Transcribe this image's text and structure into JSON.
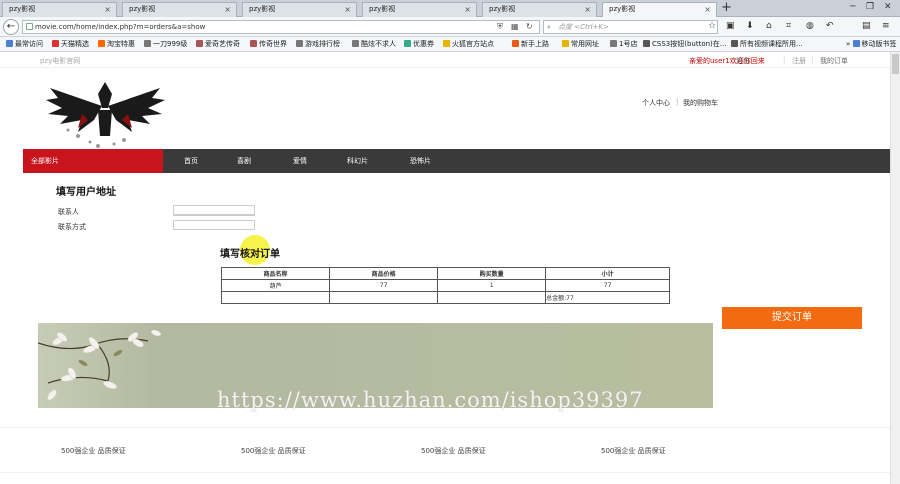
{
  "browser": {
    "tabs": [
      {
        "label": "pzy影视",
        "active": false
      },
      {
        "label": "pzy影视",
        "active": false
      },
      {
        "label": "pzy影视",
        "active": false
      },
      {
        "label": "pzy影视",
        "active": false
      },
      {
        "label": "pzy影视",
        "active": false
      },
      {
        "label": "pzy影视",
        "active": true
      }
    ],
    "tab_close": "×",
    "new_tab": "+",
    "url": "movie.com/home/index.php?m=orders&a=show",
    "search_placeholder": "点度 <Ctrl+K>",
    "bookmarks": [
      "最常访问",
      "天猫精选",
      "淘宝特惠",
      "一刀999级",
      "爱奇艺传奇",
      "传奇世界",
      "游戏排行榜",
      "酷炫不求人",
      "优惠券",
      "火狐官方站点",
      "新手上路",
      "常用网址",
      "1号店",
      "CSS3按钮(button)在...",
      "所有视频课程所用..."
    ],
    "mobile_bookmarks": "移动版书签"
  },
  "site": {
    "name": "pzy电影官网",
    "welcome": "亲爱的user1欢迎你回来",
    "logout": "退出",
    "register": "注册",
    "my_orders": "我的订单",
    "user_center": "个人中心",
    "cart": "我的购物车",
    "nav_all": "全部影片",
    "nav": [
      "首页",
      "喜剧",
      "爱情",
      "科幻片",
      "恐怖片"
    ]
  },
  "address_form": {
    "title": "填写用户地址",
    "recipient_label": "联系人",
    "contact_label": "联系方式",
    "recipient_value": "",
    "contact_value": ""
  },
  "order": {
    "title": "填写核对订单",
    "headers": [
      "商品名称",
      "商品价格",
      "购买数量",
      "小计"
    ],
    "rows": [
      [
        "葫芦",
        "77",
        "1",
        "77"
      ]
    ],
    "total": "总金额:77",
    "submit": "提交订单"
  },
  "watermark": "https://www.huzhan.com/ishop39397",
  "footer": {
    "guarantees": [
      "500强企业 品质保证",
      "500强企业 品质保证",
      "500强企业 品质保证",
      "500强企业 品质保证"
    ]
  }
}
